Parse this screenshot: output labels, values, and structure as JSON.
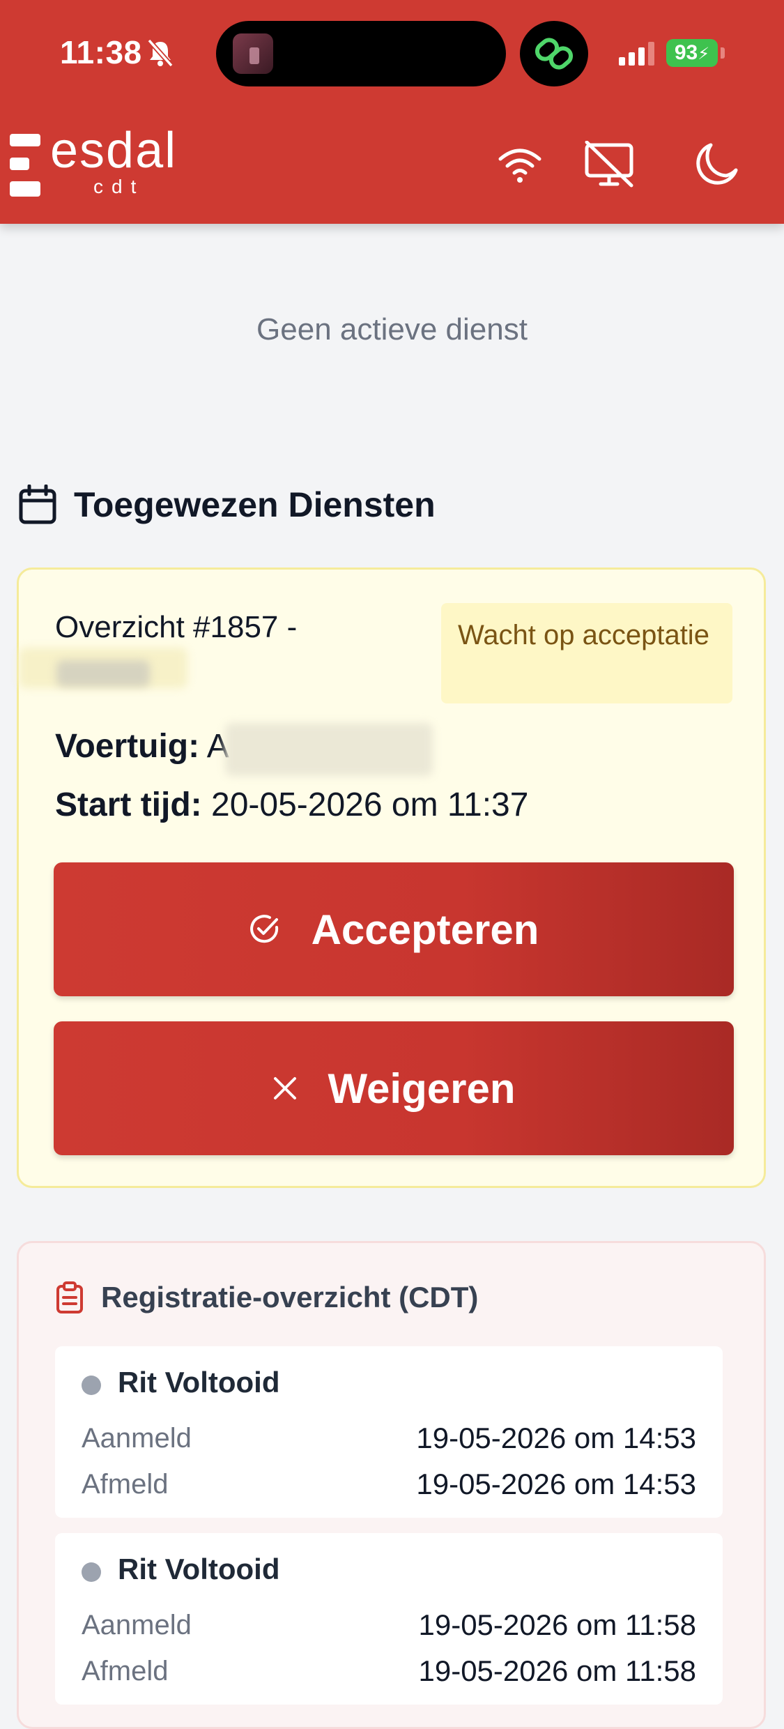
{
  "status_bar": {
    "time": "11:38",
    "battery": "93"
  },
  "header": {
    "logo_text": "esdal",
    "logo_sub": "cdt"
  },
  "main": {
    "no_active_service": "Geen actieve dienst",
    "assigned_title": "Toegewezen Diensten"
  },
  "assignment": {
    "overview_title": "Overzicht #1857 -",
    "status_badge": "Wacht op acceptatie",
    "vehicle_label": "Voertuig:",
    "vehicle_value": "A",
    "start_label": "Start tijd:",
    "start_value": "20-05-2026 om 11:37",
    "accept_label": "Accepteren",
    "reject_label": "Weigeren"
  },
  "registration": {
    "title": "Registratie-overzicht (CDT)",
    "items": [
      {
        "status": "Rit Voltooid",
        "signed_in_label": "Aanmeld",
        "signed_in": "19-05-2026 om 14:53",
        "signed_out_label": "Afmeld",
        "signed_out": "19-05-2026 om 14:53"
      },
      {
        "status": "Rit Voltooid",
        "signed_in_label": "Aanmeld",
        "signed_in": "19-05-2026 om 11:58",
        "signed_out_label": "Afmeld",
        "signed_out": "19-05-2026 om 11:58"
      }
    ]
  },
  "colors": {
    "brand_red": "#ce3a32",
    "pending_bg": "#fffde8",
    "pending_text": "#7a5414"
  }
}
